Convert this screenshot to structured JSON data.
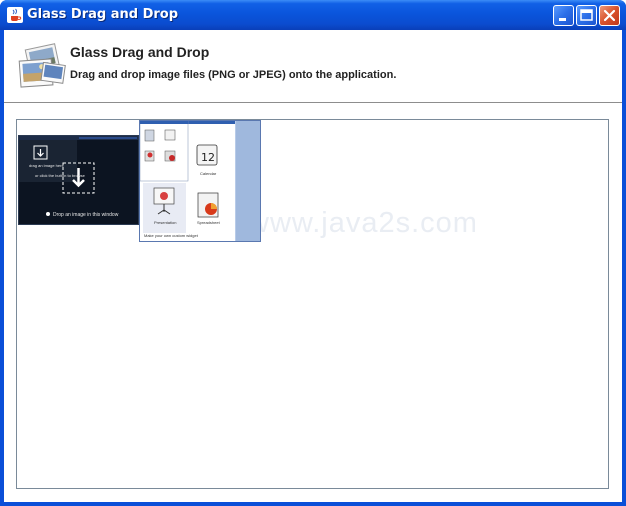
{
  "window": {
    "title": "Glass Drag and Drop",
    "accent_color": "#0a4fd8",
    "controls": {
      "minimize_icon": "minimize-icon",
      "maximize_icon": "maximize-icon",
      "close_icon": "close-icon"
    }
  },
  "header": {
    "title": "Glass Drag and Drop",
    "description": "Drag and drop image files (PNG or JPEG) onto the application.",
    "icon": "photos-icon"
  },
  "drop_area": {
    "watermark": "www.java2s.com",
    "thumbnails": [
      {
        "name": "dark-screenshot-thumbnail",
        "caption": "Drop an image in this window",
        "inner_caption_1": "drag an image here",
        "inner_caption_2": "or click the button to browse"
      },
      {
        "name": "icons-screenshot-thumbnail",
        "labels": [
          "Calendar",
          "Presentation",
          "Spreadsheet"
        ],
        "footer": "Make your own custom widget"
      }
    ]
  }
}
